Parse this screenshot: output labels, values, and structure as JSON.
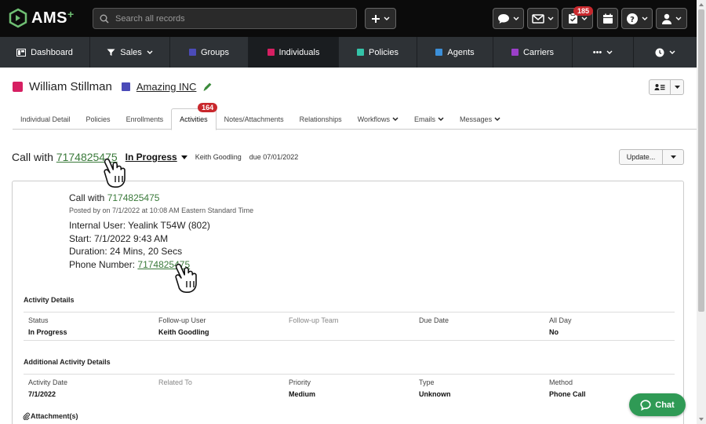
{
  "app": {
    "logo_text": "AMS",
    "logo_sup": "+"
  },
  "search": {
    "placeholder": "Search all records"
  },
  "toolbar": {
    "tasks_badge": "185"
  },
  "nav": {
    "items": [
      {
        "label": "Dashboard",
        "icon": "dashboard-icon"
      },
      {
        "label": "Sales",
        "icon": "filter-icon"
      },
      {
        "label": "Groups",
        "color": "#4b4bb8"
      },
      {
        "label": "Individuals",
        "color": "#d61f62"
      },
      {
        "label": "Policies",
        "color": "#34c3a8"
      },
      {
        "label": "Agents",
        "color": "#3b8fd9"
      },
      {
        "label": "Carriers",
        "color": "#9b3fc9"
      },
      {
        "label": "•••"
      },
      {
        "label": "",
        "icon": "clock-icon"
      }
    ]
  },
  "person": {
    "name": "William Stillman",
    "company": "Amazing INC"
  },
  "tabs": [
    {
      "label": "Individual Detail"
    },
    {
      "label": "Policies"
    },
    {
      "label": "Enrollments"
    },
    {
      "label": "Activities",
      "badge": "164"
    },
    {
      "label": "Notes/Attachments"
    },
    {
      "label": "Relationships"
    },
    {
      "label": "Workflows"
    },
    {
      "label": "Emails"
    },
    {
      "label": "Messages"
    }
  ],
  "activity": {
    "title_prefix": "Call with",
    "phone": "7174825475",
    "status": "In Progress",
    "assignee": "Keith Goodling",
    "due": "due 07/01/2022",
    "update_label": "Update..."
  },
  "note": {
    "title_prefix": "Call with",
    "phone": "7174825475",
    "posted": "Posted by on 7/1/2022 at 10:08 AM Eastern Standard Time",
    "line1": "Internal User: Yealink T54W (802)",
    "line2": "Start: 7/1/2022 9:43 AM",
    "line3": "Duration: 24 Mins, 20 Secs",
    "line4_prefix": "Phone Number:",
    "line4_phone": "7174825475"
  },
  "activity_details": {
    "heading": "Activity Details",
    "fields": [
      {
        "label": "Status",
        "value": "In Progress"
      },
      {
        "label": "Follow-up User",
        "value": "Keith Goodling"
      },
      {
        "label": "Follow-up Team",
        "value": ""
      },
      {
        "label": "Due Date",
        "value": ""
      },
      {
        "label": "All Day",
        "value": "No"
      }
    ]
  },
  "additional_details": {
    "heading": "Additional Activity Details",
    "fields": [
      {
        "label": "Activity Date",
        "value": "7/1/2022"
      },
      {
        "label": "Related To",
        "value": ""
      },
      {
        "label": "Priority",
        "value": "Medium"
      },
      {
        "label": "Type",
        "value": "Unknown"
      },
      {
        "label": "Method",
        "value": "Phone Call"
      }
    ]
  },
  "attachments": {
    "heading": "Attachment(s)"
  },
  "chat": {
    "label": "Chat"
  },
  "colors": {
    "accent_green": "#3a7a3a",
    "individual": "#d61f62",
    "badge_red": "#c9282d",
    "chat_green": "#2f9a55"
  }
}
